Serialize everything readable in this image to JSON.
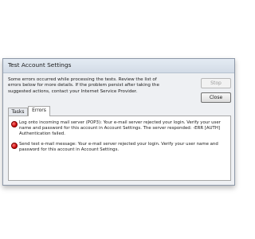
{
  "window": {
    "title": "Test Account Settings",
    "message": "Some errors occurred while processing the tests. Review the list of errors below for more details. If the problem persist after taking the suggested actions, contact your Internet Service Provider."
  },
  "buttons": {
    "stop": "Stop",
    "close": "Close"
  },
  "tabs": [
    {
      "label": "Tasks",
      "selected": false
    },
    {
      "label": "Errors",
      "selected": true
    }
  ],
  "errors": [
    {
      "icon": "error-icon",
      "text": "Log onto incoming mail server (POP3): Your e-mail server rejected your login. Verify your user name and password for this account in Account Settings. The server responded: -ERR [AUTH] Authentication failed."
    },
    {
      "icon": "error-icon",
      "text": "Send test e-mail message: Your e-mail server rejected your login. Verify your user name and password for this account in Account Settings."
    }
  ],
  "colors": {
    "error": "#c40000",
    "panel_bg": "#ffffff",
    "window_bg": "#eef0f3"
  }
}
